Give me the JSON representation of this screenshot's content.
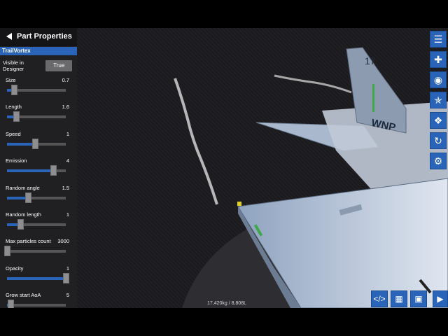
{
  "panel": {
    "title": "Part Properties",
    "part_name": "TrailVortex",
    "visible_label": "Visible in Designer",
    "visible_value": "True",
    "properties": [
      {
        "label": "Size",
        "value": "0.7",
        "fraction": 0.12
      },
      {
        "label": "Length",
        "value": "1.6",
        "fraction": 0.16
      },
      {
        "label": "Speed",
        "value": "1",
        "fraction": 0.48
      },
      {
        "label": "Emission",
        "value": "4",
        "fraction": 0.79
      },
      {
        "label": "Random angle",
        "value": "1.5",
        "fraction": 0.36
      },
      {
        "label": "Random length",
        "value": "1",
        "fraction": 0.23
      },
      {
        "label": "Max particles count",
        "value": "3000",
        "fraction": 0.0
      },
      {
        "label": "Opacity",
        "value": "1",
        "fraction": 1.0
      },
      {
        "label": "Grow start AoA",
        "value": "5",
        "fraction": 0.06
      }
    ]
  },
  "viewport": {
    "stats": "17,420kg / 8,808L",
    "tail_number": "17",
    "tail_code": "WNP"
  },
  "toolbar": {
    "icons": [
      "menu-icon",
      "add-part-icon",
      "view-icon",
      "tools-icon",
      "symmetry-icon",
      "rotate-icon",
      "settings-icon"
    ]
  },
  "bottom_bar": {
    "icons": [
      "code-aircraft-icon",
      "wing-grid-icon",
      "screenshot-icon",
      "play-icon"
    ]
  },
  "colors": {
    "accent": "#2a64b8"
  }
}
